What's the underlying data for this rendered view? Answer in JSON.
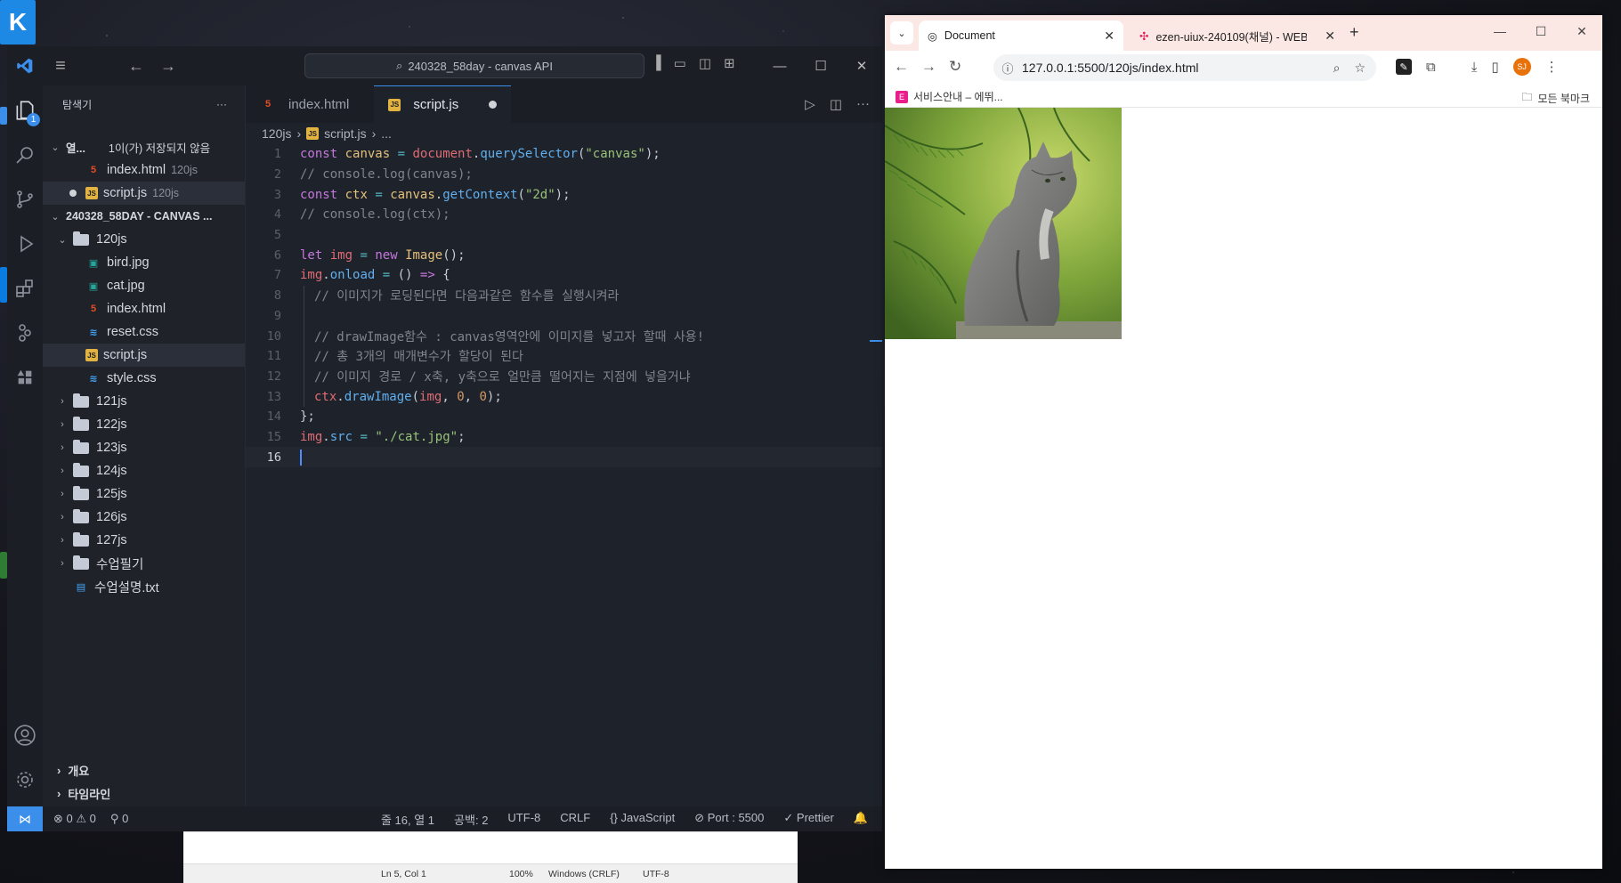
{
  "vscode": {
    "title_search": "240328_58day - canvas API",
    "sidebar": {
      "title": "탐색기",
      "open_editors_label": "열...",
      "open_editors_unsaved": "1이(가) 저장되지 않음",
      "open_files": [
        {
          "name": "index.html",
          "folder": "120js",
          "icon": "html-icon"
        },
        {
          "name": "script.js",
          "folder": "120js",
          "icon": "js-icon",
          "modified": true
        }
      ],
      "workspace_label": "240328_58DAY - CANVAS ...",
      "tree": [
        {
          "name": "120js",
          "type": "folder",
          "expanded": true
        },
        {
          "name": "bird.jpg",
          "type": "image"
        },
        {
          "name": "cat.jpg",
          "type": "image"
        },
        {
          "name": "index.html",
          "type": "html"
        },
        {
          "name": "reset.css",
          "type": "css"
        },
        {
          "name": "script.js",
          "type": "js"
        },
        {
          "name": "style.css",
          "type": "css"
        },
        {
          "name": "121js",
          "type": "folder"
        },
        {
          "name": "122js",
          "type": "folder"
        },
        {
          "name": "123js",
          "type": "folder"
        },
        {
          "name": "124js",
          "type": "folder"
        },
        {
          "name": "125js",
          "type": "folder"
        },
        {
          "name": "126js",
          "type": "folder"
        },
        {
          "name": "127js",
          "type": "folder"
        },
        {
          "name": "수업필기",
          "type": "folder"
        },
        {
          "name": "수업설명.txt",
          "type": "txt"
        }
      ],
      "outline_label": "개요",
      "timeline_label": "타임라인"
    },
    "tabs": [
      {
        "label": "index.html"
      },
      {
        "label": "script.js"
      }
    ],
    "breadcrumb": {
      "folder": "120js",
      "file": "script.js",
      "more": "..."
    },
    "line_numbers": [
      "1",
      "2",
      "3",
      "4",
      "5",
      "6",
      "7",
      "8",
      "9",
      "10",
      "11",
      "12",
      "13",
      "14",
      "15",
      "16"
    ],
    "code": {
      "l2": "// console.log(canvas);",
      "l4": "// console.log(ctx);",
      "l8": "// 이미지가 로딩된다면 다음과같은 함수를 실행시켜라",
      "l10": "// drawImage함수 : canvas영역안에 이미지를 넣고자 할때 사용!",
      "l11": "// 총 3개의 매개변수가 할당이 된다",
      "l12": "// 이미지 경로 / x축, y축으로 얼만큼 떨어지는 지점에 넣을거냐"
    },
    "activity_badge": "1",
    "status": {
      "errors": "0",
      "warnings": "0",
      "ports": "0",
      "position": "줄 16, 열 1",
      "spaces": "공백: 2",
      "encoding": "UTF-8",
      "eol": "CRLF",
      "language": "JavaScript",
      "port": "Port : 5500",
      "formatter": "Prettier"
    }
  },
  "notepad_status": {
    "position": "Ln 5, Col 1",
    "zoom": "100%",
    "eol": "Windows (CRLF)",
    "encoding": "UTF-8"
  },
  "browser": {
    "tabs": [
      {
        "label": "Document",
        "active": true
      },
      {
        "label": "ezen-uiux-240109(채널) - WEB",
        "active": false
      }
    ],
    "url": "127.0.0.1:5500/120js/index.html",
    "bookmark_item": "서비스안내 – 에뛰...",
    "bookmark_fav_letter": "E",
    "all_bookmarks": "모든 북마크",
    "avatar_initials": "SJ"
  },
  "colors": {
    "accent": "#3b8eea",
    "editor_bg": "#1e222a",
    "browser_tabbar": "#fbe8e4"
  }
}
